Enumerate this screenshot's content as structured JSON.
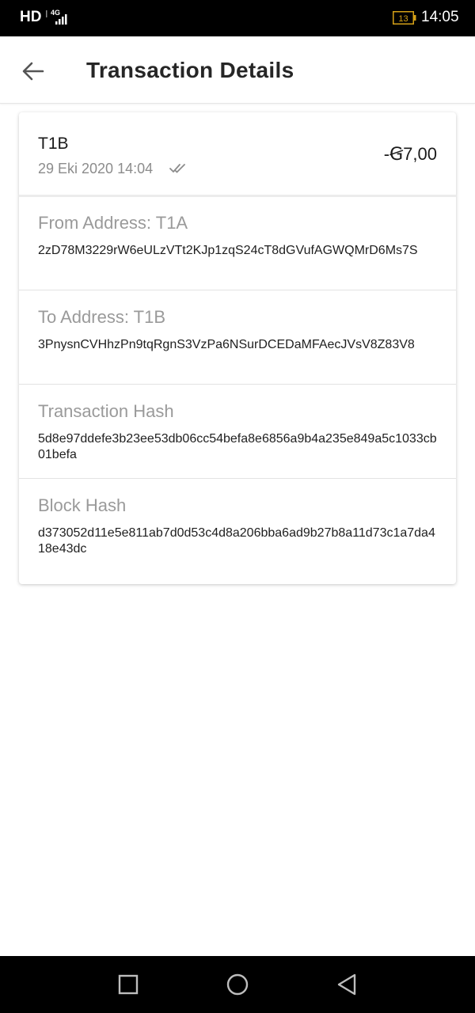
{
  "status_bar": {
    "network_hd": "HD",
    "network_type": "4G",
    "battery_level": "13",
    "time": "14:05"
  },
  "app_bar": {
    "title": "Transaction Details",
    "back_icon": "arrow-back-icon"
  },
  "transaction": {
    "name": "T1B",
    "datetime": "29 Eki 2020 14:04",
    "status_icon": "double-check-icon",
    "amount": "-Ꞡ7,00"
  },
  "details": [
    {
      "label": "From Address: T1A",
      "value": "2zD78M3229rW6eULzVTt2KJp1zqS24cT8dGVufAGWQMrD6Ms7S"
    },
    {
      "label": "To Address: T1B",
      "value": "3PnysnCVHhzPn9tqRgnS3VzPa6NSurDCEDaMFAecJVsV8Z83V8"
    },
    {
      "label": "Transaction Hash",
      "value": "5d8e97ddefe3b23ee53db06cc54befa8e6856a9b4a235e849a5c1033cb01befa"
    },
    {
      "label": "Block Hash",
      "value": "d373052d11e5e811ab7d0d53c4d8a206bba6ad9b27b8a11d73c1a7da418e43dc"
    }
  ],
  "nav_bar": {
    "recents_icon": "square-recents-icon",
    "home_icon": "circle-home-icon",
    "back_icon": "triangle-back-icon"
  },
  "colors": {
    "title": "#262626",
    "label_gray": "#9a9a9a",
    "battery_accent": "#d4a017"
  }
}
